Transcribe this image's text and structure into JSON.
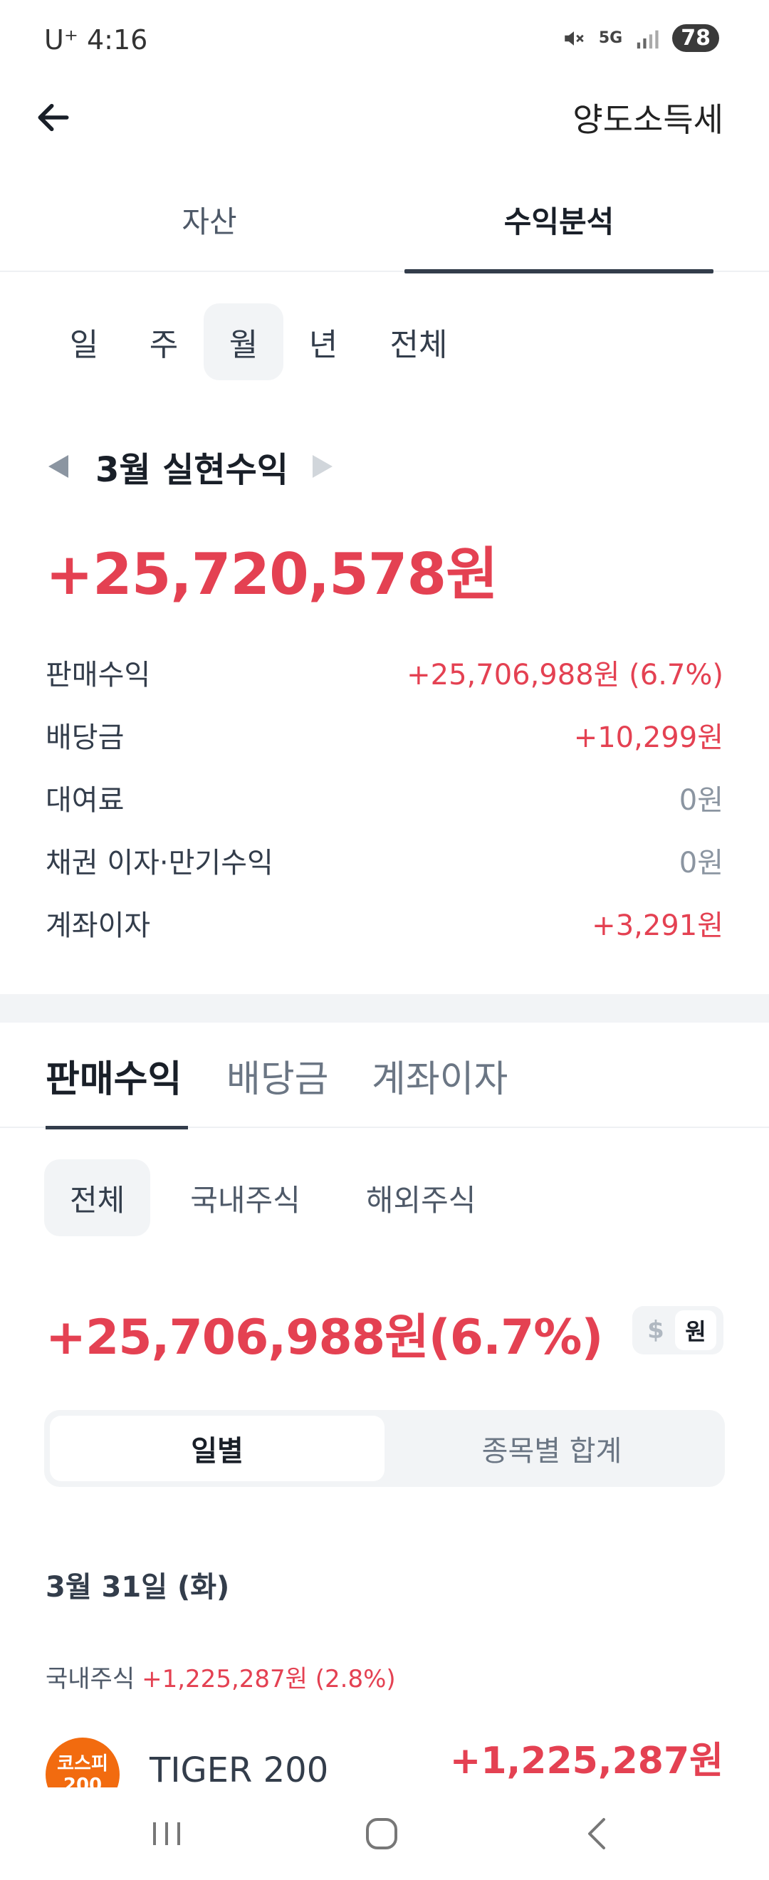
{
  "status_bar": {
    "carrier": "U⁺",
    "time": "4:16",
    "network": "5G",
    "battery": "78"
  },
  "header": {
    "title": "양도소득세"
  },
  "top_tabs": [
    {
      "label": "자산",
      "active": false
    },
    {
      "label": "수익분석",
      "active": true
    }
  ],
  "period_tabs": [
    {
      "label": "일",
      "active": false
    },
    {
      "label": "주",
      "active": false
    },
    {
      "label": "월",
      "active": true
    },
    {
      "label": "년",
      "active": false
    },
    {
      "label": "전체",
      "active": false
    }
  ],
  "month_nav": {
    "label": "3월 실현수익"
  },
  "realized_total": "+25,720,578원",
  "breakdown": [
    {
      "label": "판매수익",
      "value": "+25,706,988원 (6.7%)",
      "tone": "positive"
    },
    {
      "label": "배당금",
      "value": "+10,299원",
      "tone": "positive"
    },
    {
      "label": "대여료",
      "value": "0원",
      "tone": "zero"
    },
    {
      "label": "채권 이자·만기수익",
      "value": "0원",
      "tone": "zero"
    },
    {
      "label": "계좌이자",
      "value": "+3,291원",
      "tone": "positive"
    }
  ],
  "sub_tabs": [
    {
      "label": "판매수익",
      "active": true
    },
    {
      "label": "배당금",
      "active": false
    },
    {
      "label": "계좌이자",
      "active": false
    }
  ],
  "market_filters": [
    {
      "label": "전체",
      "active": true
    },
    {
      "label": "국내주식",
      "active": false
    },
    {
      "label": "해외주식",
      "active": false
    }
  ],
  "sales_total": "+25,706,988원(6.7%)",
  "currency_toggle": {
    "dollar": "$",
    "won": "원",
    "selected": "원"
  },
  "view_segment": [
    {
      "label": "일별",
      "active": true
    },
    {
      "label": "종목별 합계",
      "active": false
    }
  ],
  "date_heading": "3월 31일 (화)",
  "market_summary": {
    "label": "국내주식",
    "value": "+1,225,287원 (2.8%)"
  },
  "stock": {
    "logo_line1": "코스피",
    "logo_line2": "200",
    "name": "TIGER 200",
    "profit": "+1,225,287원"
  },
  "colors": {
    "positive": "#e44152",
    "neutral": "#8b95a1",
    "accent_dark": "#333d4b",
    "chip_bg": "#f2f4f6",
    "logo_orange": "#f26b0f"
  }
}
